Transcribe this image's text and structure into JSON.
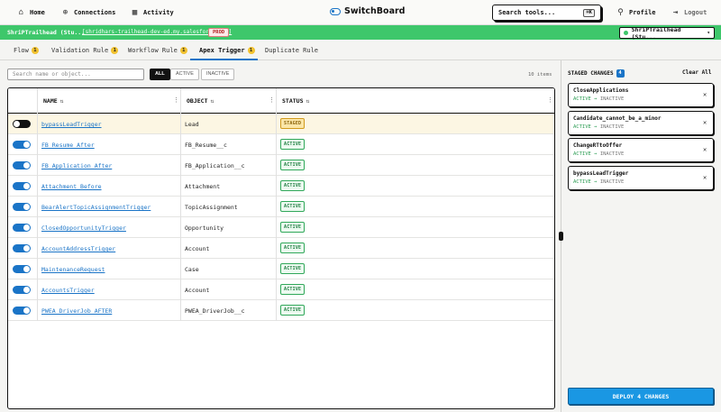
{
  "nav": {
    "home": "Home",
    "connections": "Connections",
    "activity": "Activity",
    "brand": "SwitchBoard",
    "search_tools": "Search tools...",
    "search_shortcut": "⌘K",
    "profile": "Profile",
    "logout": "Logout"
  },
  "org": {
    "name": "ShriPTrailhead (Stu...",
    "url": "[shridhars-trailhead-dev-ed.my.salesforce.com]",
    "env_badge": "PROD",
    "selector_label": "ShriPTrailhead (Stu..."
  },
  "tabs": [
    {
      "label": "Flow",
      "count": "1"
    },
    {
      "label": "Validation Rule",
      "count": "1"
    },
    {
      "label": "Workflow Rule",
      "count": "1"
    },
    {
      "label": "Apex Trigger",
      "count": "1"
    },
    {
      "label": "Duplicate Rule",
      "count": ""
    }
  ],
  "filters": {
    "search_placeholder": "Search name or object...",
    "all": "ALL",
    "active": "ACTIVE",
    "inactive": "INACTIVE",
    "items_count": "10 items"
  },
  "table": {
    "headers": {
      "name": "NAME",
      "object": "OBJECT",
      "status": "STATUS"
    },
    "rows": [
      {
        "on": false,
        "name": "bypassLeadTrigger",
        "object": "Lead",
        "status": "STAGED"
      },
      {
        "on": true,
        "name": "FB_Resume_After",
        "object": "FB_Resume__c",
        "status": "ACTIVE"
      },
      {
        "on": true,
        "name": "FB_Application_After",
        "object": "FB_Application__c",
        "status": "ACTIVE"
      },
      {
        "on": true,
        "name": "Attachment_Before",
        "object": "Attachment",
        "status": "ACTIVE"
      },
      {
        "on": true,
        "name": "BearAlertTopicAssignmentTrigger",
        "object": "TopicAssignment",
        "status": "ACTIVE"
      },
      {
        "on": true,
        "name": "ClosedOpportunityTrigger",
        "object": "Opportunity",
        "status": "ACTIVE"
      },
      {
        "on": true,
        "name": "AccountAddressTrigger",
        "object": "Account",
        "status": "ACTIVE"
      },
      {
        "on": true,
        "name": "MaintenanceRequest",
        "object": "Case",
        "status": "ACTIVE"
      },
      {
        "on": true,
        "name": "AccountsTrigger",
        "object": "Account",
        "status": "ACTIVE"
      },
      {
        "on": true,
        "name": "PWEA_DriverJob_AFTER",
        "object": "PWEA_DriverJob__c",
        "status": "ACTIVE"
      }
    ]
  },
  "staged": {
    "title": "STAGED CHANGES",
    "count": "4",
    "clear_all": "Clear All",
    "items": [
      {
        "name": "CloseApplications",
        "from": "ACTIVE",
        "to": "INACTIVE"
      },
      {
        "name": "Candidate_cannot_be_a_minor",
        "from": "ACTIVE",
        "to": "INACTIVE"
      },
      {
        "name": "ChangeRTtoOffer",
        "from": "ACTIVE",
        "to": "INACTIVE"
      },
      {
        "name": "bypassLeadTrigger",
        "from": "ACTIVE",
        "to": "INACTIVE"
      }
    ],
    "deploy_label": "DEPLOY 4 CHANGES"
  },
  "colors": {
    "accent": "#1a74c7",
    "org_bar": "#3ec76b",
    "staged_row": "#fcf6e3",
    "deploy": "#1a97e3"
  },
  "icons": {
    "home": "home-icon",
    "connections": "globe-icon",
    "activity": "calendar-icon",
    "profile": "user-icon",
    "logout": "logout-icon"
  }
}
